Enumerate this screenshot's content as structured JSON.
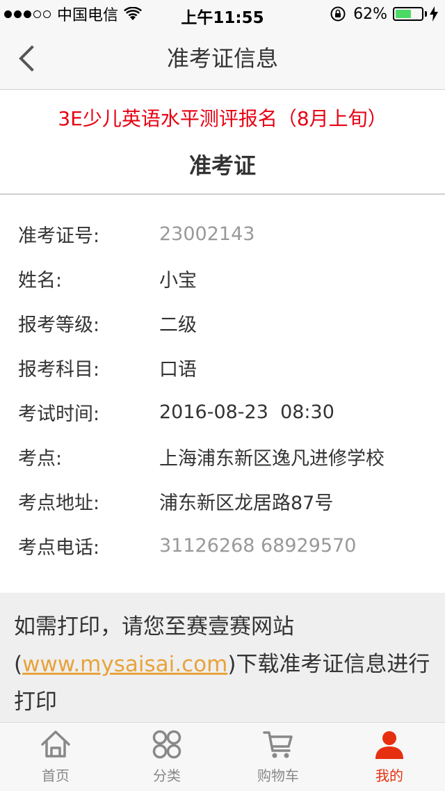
{
  "status_bar": {
    "carrier": "中国电信",
    "time": "上午11:55",
    "battery_percent": "62%",
    "battery_level": 0.62,
    "signal_bars": 3,
    "signal_total": 5
  },
  "nav": {
    "title": "准考证信息",
    "back_icon": "chevron-left-icon"
  },
  "header": {
    "exam_name": "3E少儿英语水平测评报名（8月上旬）",
    "exam_name_color": "#e60012",
    "card_title": "准考证"
  },
  "info": [
    {
      "label": "准考证号:",
      "value": "23002143",
      "muted": true
    },
    {
      "label": "姓名:",
      "value": "小宝",
      "muted": false
    },
    {
      "label": "报考等级:",
      "value": "二级",
      "muted": false
    },
    {
      "label": "报考科目:",
      "value": "口语",
      "muted": false
    },
    {
      "label": "考试时间:",
      "value": "2016-08-23  08:30",
      "muted": false
    },
    {
      "label": "考点:",
      "value": "上海浦东新区逸凡进修学校",
      "muted": false
    },
    {
      "label": "考点地址:",
      "value": "浦东新区龙居路87号",
      "muted": false
    },
    {
      "label": "考点电话:",
      "value": "31126268 68929570",
      "muted": true
    }
  ],
  "notice": {
    "line1": "如需打印，请您至赛壹赛网站",
    "paren_open": "(",
    "link": "www.mysaisai.com",
    "text_after_link": ")下载准考证信息进行",
    "line3": "打印",
    "link_color": "#e8a33b"
  },
  "tabs": [
    {
      "label": "首页",
      "icon": "home-icon",
      "active": false
    },
    {
      "label": "分类",
      "icon": "category-icon",
      "active": false
    },
    {
      "label": "购物车",
      "icon": "cart-icon",
      "active": false
    },
    {
      "label": "我的",
      "icon": "user-icon",
      "active": true
    }
  ],
  "colors": {
    "accent": "#e62f0f",
    "inactive_tab": "#888888"
  }
}
